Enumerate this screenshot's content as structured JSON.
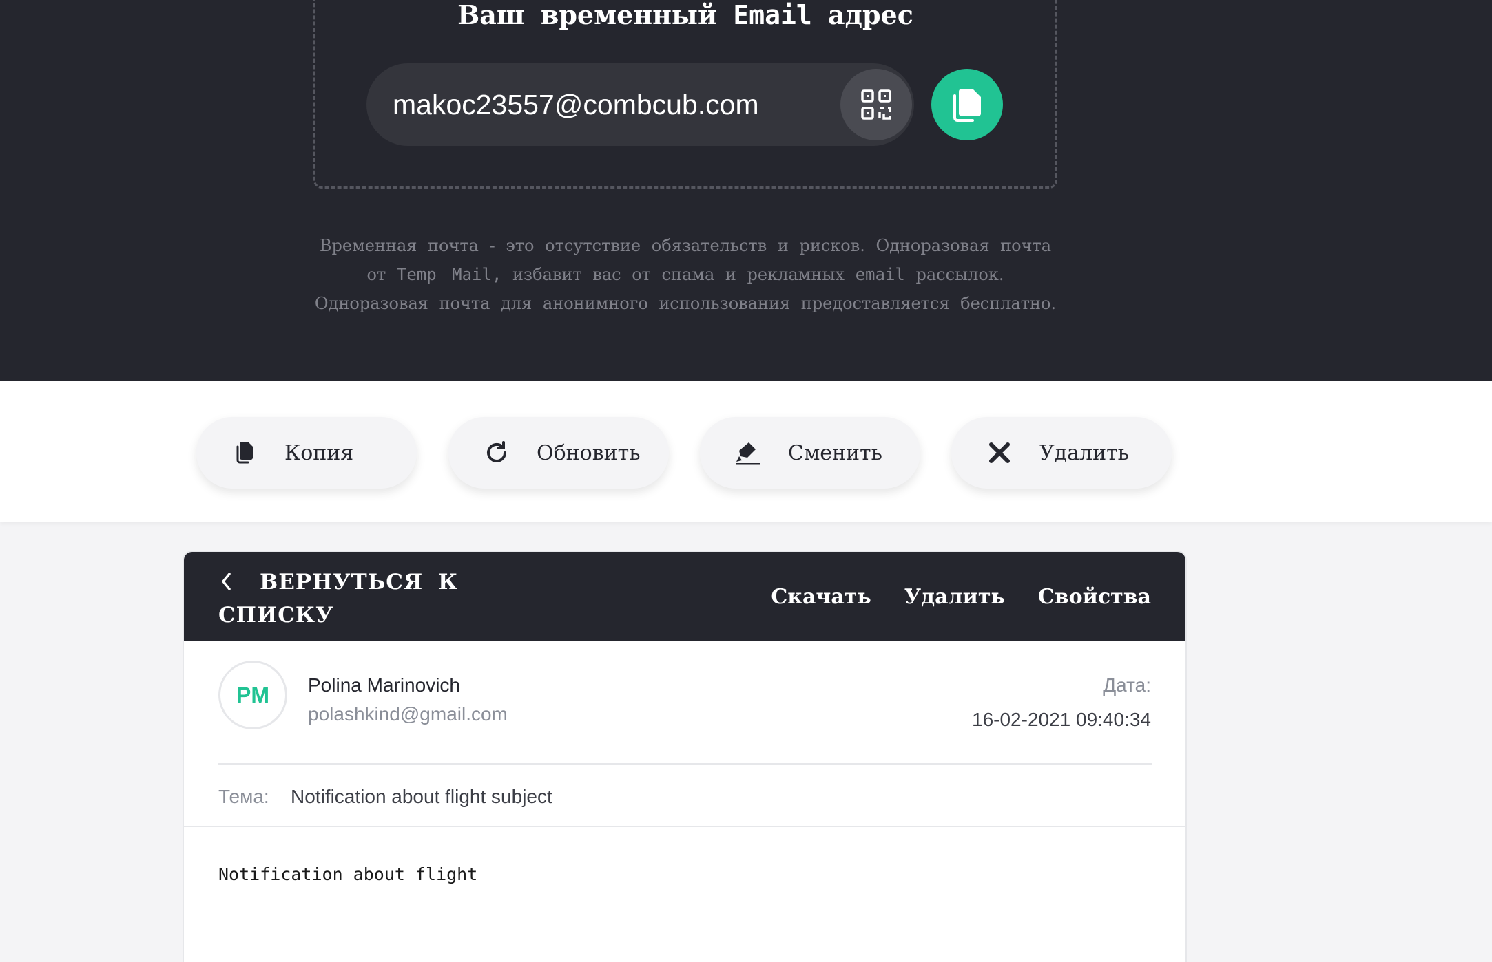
{
  "hero": {
    "title_prefix": "Ваш временный",
    "title_mono": "Email",
    "title_suffix": "адрес",
    "email": "makoc23557@combcub.com",
    "qr_icon": "qr-code-icon",
    "copy_icon": "copy-icon",
    "desc_part1": "Временная почта - это отсутствие обязательств и рисков. Одноразовая почта от",
    "desc_mono1": "Temp Mail,",
    "desc_part2": "избавит вас от спама и рекламных",
    "desc_mono2": "email",
    "desc_part3": "рассылок. Одноразовая почта для анонимного использования предоставляется бесплатно."
  },
  "actions": {
    "copy_label": "Копия",
    "refresh_label": "Обновить",
    "change_label": "Сменить",
    "delete_label": "Удалить"
  },
  "message": {
    "back_label": "ВЕРНУТЬСЯ К СПИСКУ",
    "download_label": "Скачать",
    "delete_label": "Удалить",
    "properties_label": "Свойства",
    "avatar_initials": "PM",
    "sender_name": "Polina Marinovich",
    "sender_email": "polashkind@gmail.com",
    "date_label": "Дата:",
    "date_value": "16-02-2021 09:40:34",
    "subject_label": "Тема:",
    "subject_value": "Notification about flight subject",
    "body": "Notification about flight"
  },
  "colors": {
    "dark_bg": "#25262e",
    "accent": "#21c393",
    "muted_text": "#8a8e98"
  }
}
